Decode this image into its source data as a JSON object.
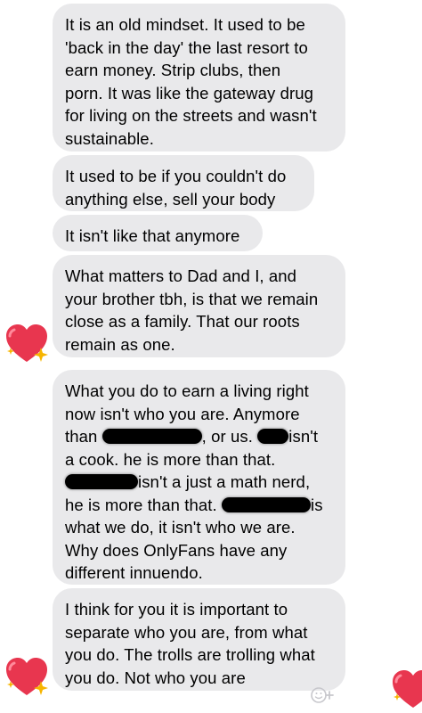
{
  "messages": [
    {
      "lines": [
        "It is an old mindset. It used to be",
        "'back in the day' the last resort to",
        "earn money. Strip clubs, then",
        "porn. It was like the gateway drug",
        "for living on the streets and wasn't",
        "sustainable."
      ]
    },
    {
      "lines": [
        "It used to be if you couldn't do",
        "anything else, sell your body"
      ]
    },
    {
      "lines": [
        "It isn't like that anymore"
      ]
    },
    {
      "lines": [
        "What matters to Dad and I, and",
        "your brother tbh, is that we remain",
        "close as a family. That our roots",
        "remain as one."
      ],
      "reaction": "sparkling-heart"
    },
    {
      "lines": [
        "What you do to earn a living right",
        "now isn't who you are. Anymore",
        "than",
        ", or us.",
        "isn't",
        "a cook. he is more than that.",
        "isn't a just a math nerd,",
        "he is more than that.",
        "is",
        "what we do, it isn't who we are.",
        "Why does OnlyFans have any",
        "different innuendo."
      ],
      "redacted_names": 4
    },
    {
      "lines": [
        "I think for you it is important to",
        "separate who you are, from what",
        "you do. The trolls are trolling what",
        "you do. Not who you are"
      ],
      "reaction": "sparkling-heart"
    }
  ],
  "reactions": {
    "icon": "sparkling-heart",
    "heart_color": "#e8364f",
    "sparkle_color": "#f7b500"
  },
  "add_reaction_icon": "smiley-plus-icon",
  "bubble_color": "#e9e9eb"
}
